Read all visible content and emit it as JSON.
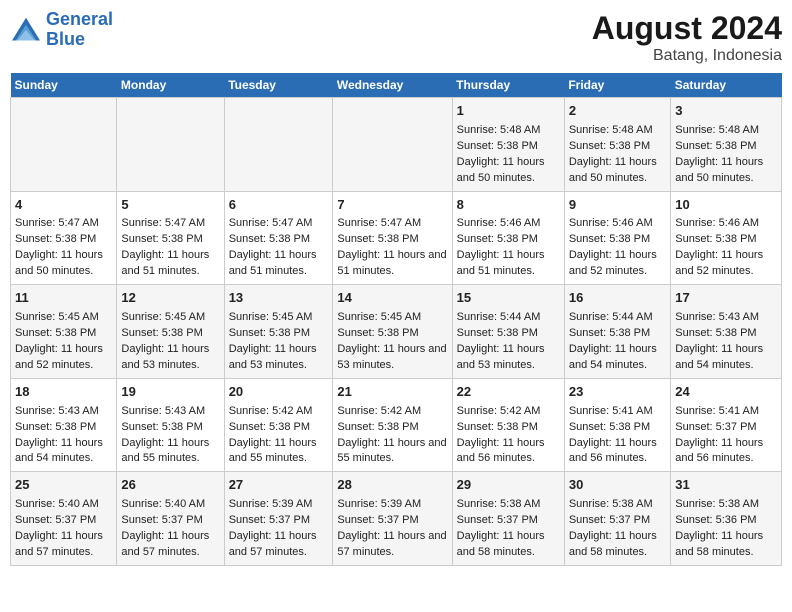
{
  "logo": {
    "text_general": "General",
    "text_blue": "Blue"
  },
  "title": "August 2024",
  "subtitle": "Batang, Indonesia",
  "days_of_week": [
    "Sunday",
    "Monday",
    "Tuesday",
    "Wednesday",
    "Thursday",
    "Friday",
    "Saturday"
  ],
  "weeks": [
    [
      {
        "day": "",
        "sunrise": "",
        "sunset": "",
        "daylight": ""
      },
      {
        "day": "",
        "sunrise": "",
        "sunset": "",
        "daylight": ""
      },
      {
        "day": "",
        "sunrise": "",
        "sunset": "",
        "daylight": ""
      },
      {
        "day": "",
        "sunrise": "",
        "sunset": "",
        "daylight": ""
      },
      {
        "day": "1",
        "sunrise": "Sunrise: 5:48 AM",
        "sunset": "Sunset: 5:38 PM",
        "daylight": "Daylight: 11 hours and 50 minutes."
      },
      {
        "day": "2",
        "sunrise": "Sunrise: 5:48 AM",
        "sunset": "Sunset: 5:38 PM",
        "daylight": "Daylight: 11 hours and 50 minutes."
      },
      {
        "day": "3",
        "sunrise": "Sunrise: 5:48 AM",
        "sunset": "Sunset: 5:38 PM",
        "daylight": "Daylight: 11 hours and 50 minutes."
      }
    ],
    [
      {
        "day": "4",
        "sunrise": "Sunrise: 5:47 AM",
        "sunset": "Sunset: 5:38 PM",
        "daylight": "Daylight: 11 hours and 50 minutes."
      },
      {
        "day": "5",
        "sunrise": "Sunrise: 5:47 AM",
        "sunset": "Sunset: 5:38 PM",
        "daylight": "Daylight: 11 hours and 51 minutes."
      },
      {
        "day": "6",
        "sunrise": "Sunrise: 5:47 AM",
        "sunset": "Sunset: 5:38 PM",
        "daylight": "Daylight: 11 hours and 51 minutes."
      },
      {
        "day": "7",
        "sunrise": "Sunrise: 5:47 AM",
        "sunset": "Sunset: 5:38 PM",
        "daylight": "Daylight: 11 hours and 51 minutes."
      },
      {
        "day": "8",
        "sunrise": "Sunrise: 5:46 AM",
        "sunset": "Sunset: 5:38 PM",
        "daylight": "Daylight: 11 hours and 51 minutes."
      },
      {
        "day": "9",
        "sunrise": "Sunrise: 5:46 AM",
        "sunset": "Sunset: 5:38 PM",
        "daylight": "Daylight: 11 hours and 52 minutes."
      },
      {
        "day": "10",
        "sunrise": "Sunrise: 5:46 AM",
        "sunset": "Sunset: 5:38 PM",
        "daylight": "Daylight: 11 hours and 52 minutes."
      }
    ],
    [
      {
        "day": "11",
        "sunrise": "Sunrise: 5:45 AM",
        "sunset": "Sunset: 5:38 PM",
        "daylight": "Daylight: 11 hours and 52 minutes."
      },
      {
        "day": "12",
        "sunrise": "Sunrise: 5:45 AM",
        "sunset": "Sunset: 5:38 PM",
        "daylight": "Daylight: 11 hours and 53 minutes."
      },
      {
        "day": "13",
        "sunrise": "Sunrise: 5:45 AM",
        "sunset": "Sunset: 5:38 PM",
        "daylight": "Daylight: 11 hours and 53 minutes."
      },
      {
        "day": "14",
        "sunrise": "Sunrise: 5:45 AM",
        "sunset": "Sunset: 5:38 PM",
        "daylight": "Daylight: 11 hours and 53 minutes."
      },
      {
        "day": "15",
        "sunrise": "Sunrise: 5:44 AM",
        "sunset": "Sunset: 5:38 PM",
        "daylight": "Daylight: 11 hours and 53 minutes."
      },
      {
        "day": "16",
        "sunrise": "Sunrise: 5:44 AM",
        "sunset": "Sunset: 5:38 PM",
        "daylight": "Daylight: 11 hours and 54 minutes."
      },
      {
        "day": "17",
        "sunrise": "Sunrise: 5:43 AM",
        "sunset": "Sunset: 5:38 PM",
        "daylight": "Daylight: 11 hours and 54 minutes."
      }
    ],
    [
      {
        "day": "18",
        "sunrise": "Sunrise: 5:43 AM",
        "sunset": "Sunset: 5:38 PM",
        "daylight": "Daylight: 11 hours and 54 minutes."
      },
      {
        "day": "19",
        "sunrise": "Sunrise: 5:43 AM",
        "sunset": "Sunset: 5:38 PM",
        "daylight": "Daylight: 11 hours and 55 minutes."
      },
      {
        "day": "20",
        "sunrise": "Sunrise: 5:42 AM",
        "sunset": "Sunset: 5:38 PM",
        "daylight": "Daylight: 11 hours and 55 minutes."
      },
      {
        "day": "21",
        "sunrise": "Sunrise: 5:42 AM",
        "sunset": "Sunset: 5:38 PM",
        "daylight": "Daylight: 11 hours and 55 minutes."
      },
      {
        "day": "22",
        "sunrise": "Sunrise: 5:42 AM",
        "sunset": "Sunset: 5:38 PM",
        "daylight": "Daylight: 11 hours and 56 minutes."
      },
      {
        "day": "23",
        "sunrise": "Sunrise: 5:41 AM",
        "sunset": "Sunset: 5:38 PM",
        "daylight": "Daylight: 11 hours and 56 minutes."
      },
      {
        "day": "24",
        "sunrise": "Sunrise: 5:41 AM",
        "sunset": "Sunset: 5:37 PM",
        "daylight": "Daylight: 11 hours and 56 minutes."
      }
    ],
    [
      {
        "day": "25",
        "sunrise": "Sunrise: 5:40 AM",
        "sunset": "Sunset: 5:37 PM",
        "daylight": "Daylight: 11 hours and 57 minutes."
      },
      {
        "day": "26",
        "sunrise": "Sunrise: 5:40 AM",
        "sunset": "Sunset: 5:37 PM",
        "daylight": "Daylight: 11 hours and 57 minutes."
      },
      {
        "day": "27",
        "sunrise": "Sunrise: 5:39 AM",
        "sunset": "Sunset: 5:37 PM",
        "daylight": "Daylight: 11 hours and 57 minutes."
      },
      {
        "day": "28",
        "sunrise": "Sunrise: 5:39 AM",
        "sunset": "Sunset: 5:37 PM",
        "daylight": "Daylight: 11 hours and 57 minutes."
      },
      {
        "day": "29",
        "sunrise": "Sunrise: 5:38 AM",
        "sunset": "Sunset: 5:37 PM",
        "daylight": "Daylight: 11 hours and 58 minutes."
      },
      {
        "day": "30",
        "sunrise": "Sunrise: 5:38 AM",
        "sunset": "Sunset: 5:37 PM",
        "daylight": "Daylight: 11 hours and 58 minutes."
      },
      {
        "day": "31",
        "sunrise": "Sunrise: 5:38 AM",
        "sunset": "Sunset: 5:36 PM",
        "daylight": "Daylight: 11 hours and 58 minutes."
      }
    ]
  ]
}
